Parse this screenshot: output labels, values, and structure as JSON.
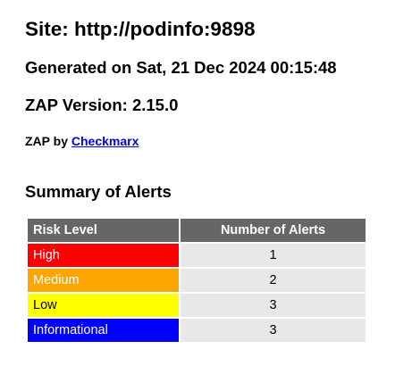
{
  "report": {
    "site_title": "Site: http://podinfo:9898",
    "generated": "Generated on Sat, 21 Dec 2024 00:15:48",
    "zap_version": "ZAP Version: 2.15.0",
    "by_prefix": "ZAP by",
    "by_link": "Checkmarx"
  },
  "summary": {
    "title": "Summary of Alerts",
    "headers": {
      "risk": "Risk Level",
      "count": "Number of Alerts"
    },
    "rows": [
      {
        "risk": "High",
        "count": "1",
        "color": "#ff0000"
      },
      {
        "risk": "Medium",
        "count": "2",
        "color": "#ffa500"
      },
      {
        "risk": "Low",
        "count": "3",
        "color": "#ffff00"
      },
      {
        "risk": "Informational",
        "count": "3",
        "color": "#0000ff"
      }
    ]
  }
}
